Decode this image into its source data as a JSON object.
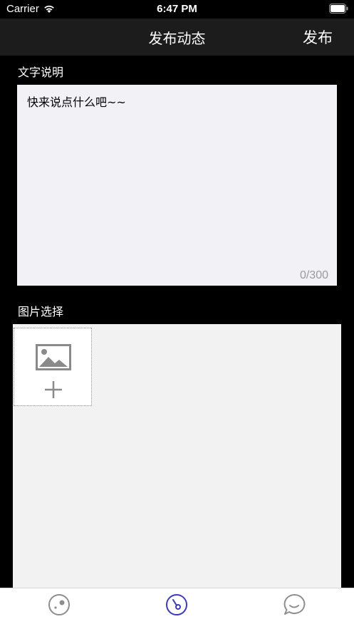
{
  "status_bar": {
    "carrier": "Carrier",
    "time": "6:47 PM"
  },
  "nav": {
    "title": "发布动态",
    "publish_label": "发布"
  },
  "text_section": {
    "label": "文字说明",
    "placeholder": "快来说点什么吧~~",
    "char_count": "0/300"
  },
  "image_section": {
    "label": "图片选择"
  },
  "tab_bar": {
    "items": [
      {
        "icon": "compass-icon",
        "selected": false
      },
      {
        "icon": "gauge-icon",
        "selected": true
      },
      {
        "icon": "chat-bubble-icon",
        "selected": false
      }
    ],
    "active_color": "#3b3bb8",
    "inactive_color": "#8e8e8e"
  },
  "colors": {
    "background": "#000000",
    "nav_background": "#1c1c1c",
    "input_background": "#f1f1f6",
    "picker_background": "#f2f2f2"
  }
}
